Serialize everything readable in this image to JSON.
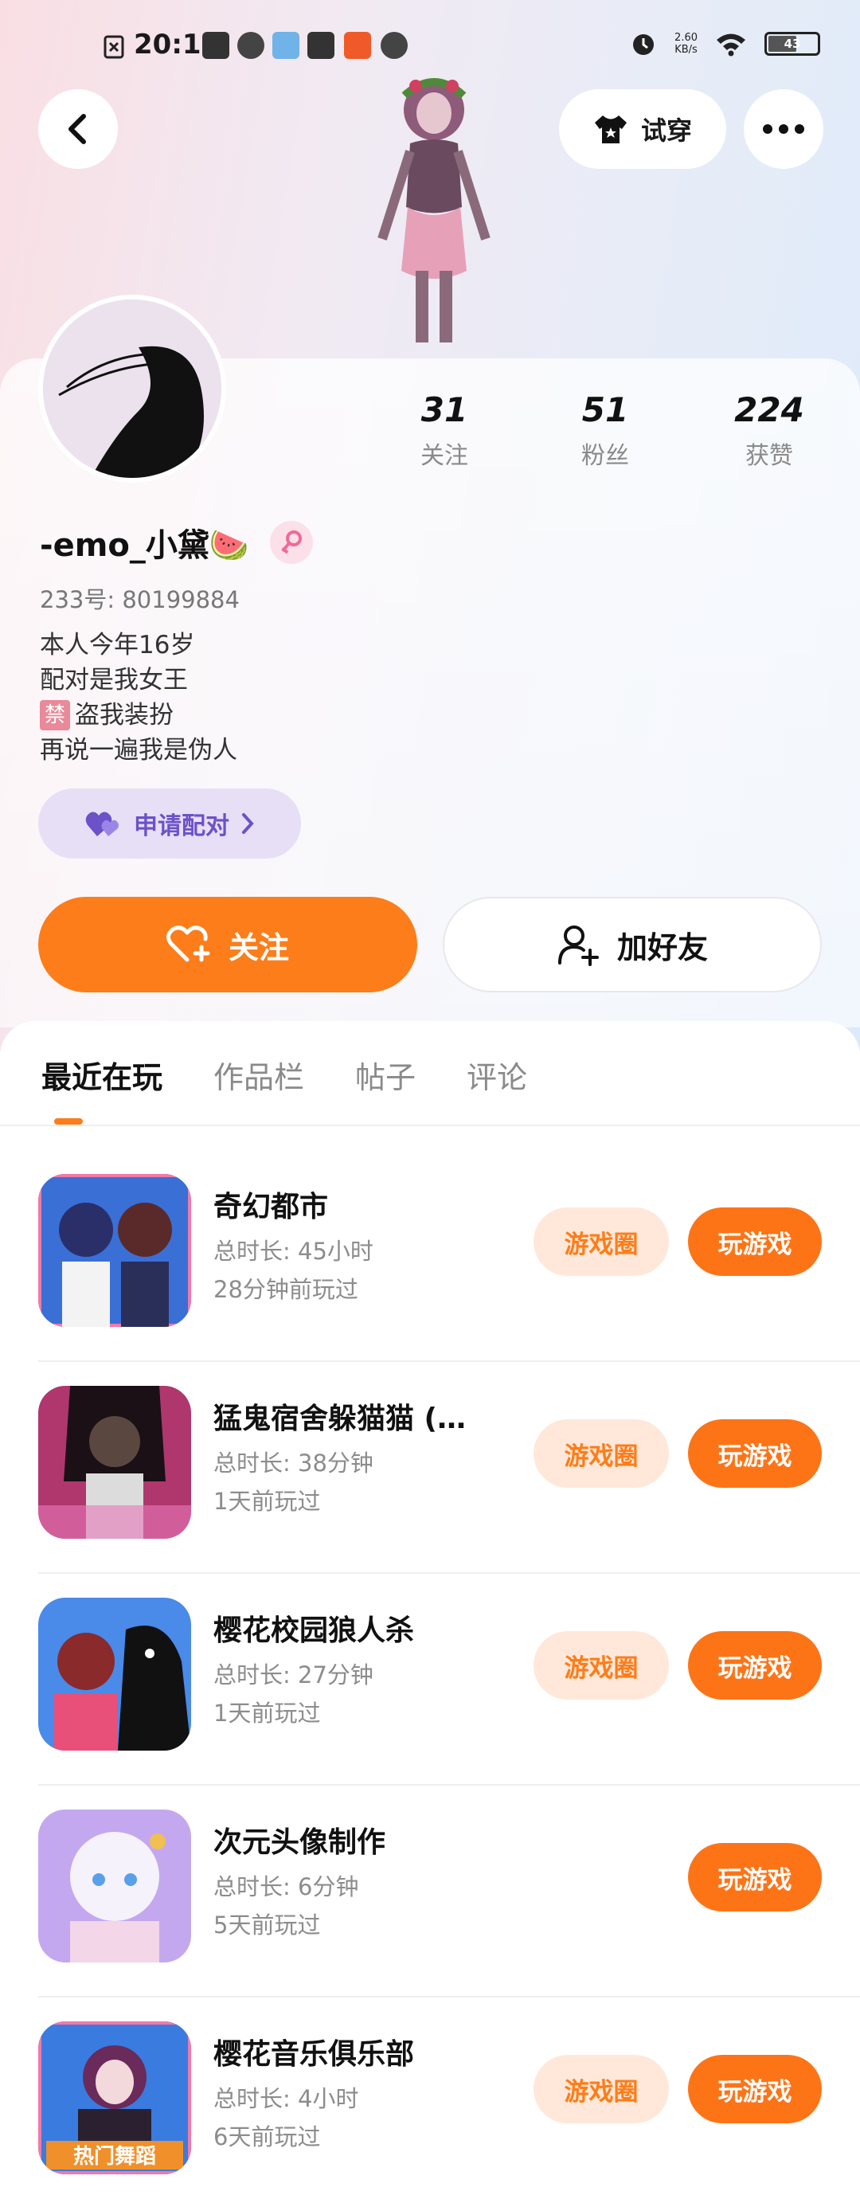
{
  "status_bar": {
    "time": "20:12",
    "net_speed_value": "2.60",
    "net_speed_unit": "KB/s",
    "battery": "43"
  },
  "header": {
    "tryon_label": "试穿"
  },
  "profile": {
    "stats": [
      {
        "value": "31",
        "label": "关注"
      },
      {
        "value": "51",
        "label": "粉丝"
      },
      {
        "value": "224",
        "label": "获赞"
      }
    ],
    "nickname": "-emo_小黛🍉",
    "uid": "233号: 80199884",
    "bio": {
      "line1": "本人今年16岁",
      "line2": "配对是我女王",
      "line3_tag": "禁",
      "line3": "盗我装扮",
      "line4": "再说一遍我是伪人"
    },
    "pair_label": "申请配对",
    "follow_label": "关注",
    "add_friend_label": "加好友"
  },
  "tabs": [
    "最近在玩",
    "作品栏",
    "帖子",
    "评论"
  ],
  "games": [
    {
      "title": "奇幻都市",
      "duration": "总时长: 45小时",
      "last_played": "28分钟前玩过",
      "circle_label": "游戏圈",
      "play_label": "玩游戏",
      "thumb_color": "#3a6fd6"
    },
    {
      "title": "猛鬼宿舍躲猫猫 (…",
      "duration": "总时长: 38分钟",
      "last_played": "1天前玩过",
      "circle_label": "游戏圈",
      "play_label": "玩游戏",
      "thumb_color": "#b0376e"
    },
    {
      "title": "樱花校园狼人杀",
      "duration": "总时长: 27分钟",
      "last_played": "1天前玩过",
      "circle_label": "游戏圈",
      "play_label": "玩游戏",
      "thumb_color": "#e8507a"
    },
    {
      "title": "次元头像制作",
      "duration": "总时长: 6分钟",
      "last_played": "5天前玩过",
      "circle_label": "",
      "play_label": "玩游戏",
      "thumb_color": "#b99be8"
    },
    {
      "title": "樱花音乐俱乐部",
      "duration": "总时长: 4小时",
      "last_played": "6天前玩过",
      "circle_label": "游戏圈",
      "play_label": "玩游戏",
      "thumb_color": "#3a7be0",
      "thumb_badge": "热门舞蹈"
    }
  ],
  "colors": {
    "accent": "#fd7d1a",
    "pair": "#6b52c9"
  }
}
